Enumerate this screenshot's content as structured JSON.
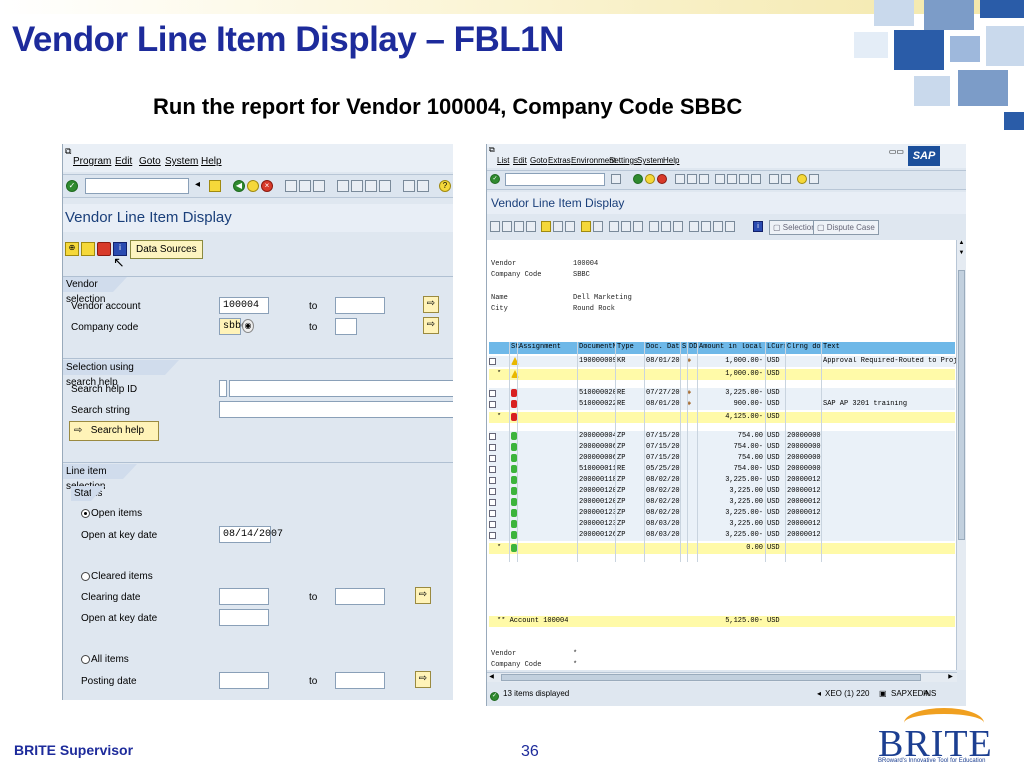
{
  "slide": {
    "title": "Vendor Line Item Display – FBL1N",
    "subtitle": "Run the report for Vendor 100004, Company Code SBBC",
    "footer_left": "BRITE Supervisor",
    "page_number": "36",
    "logo_word": "BRITE",
    "logo_tagline": "BRoward's Innovative Tool for Education"
  },
  "left_window": {
    "menu": [
      "Program",
      "Edit",
      "Goto",
      "System",
      "Help"
    ],
    "title": "Vendor Line Item Display",
    "data_sources_label": "Data Sources",
    "vendor_selection": {
      "header": "Vendor selection",
      "vendor_account_label": "Vendor account",
      "vendor_account_value": "100004",
      "company_code_label": "Company code",
      "company_code_value": "sbbc",
      "to_label": "to"
    },
    "search_help": {
      "header": "Selection using search help",
      "search_help_id_label": "Search help ID",
      "search_string_label": "Search string",
      "search_help_button": "Search help"
    },
    "line_item": {
      "header": "Line item selection",
      "status_label": "Status",
      "open_items_label": "Open items",
      "open_at_key_date_label": "Open at key date",
      "open_at_key_date_value": "08/14/2007",
      "cleared_items_label": "Cleared items",
      "clearing_date_label": "Clearing date",
      "cleared_open_at_key_date_label": "Open at key date",
      "all_items_label": "All items",
      "posting_date_label": "Posting date",
      "to_label": "to"
    }
  },
  "right_window": {
    "menu": [
      "List",
      "Edit",
      "Goto",
      "Extras",
      "Environment",
      "Settings",
      "System",
      "Help"
    ],
    "sap_logo": "SAP",
    "title": "Vendor Line Item Display",
    "selections_label": "Selections",
    "dispute_case_label": "Dispute Case",
    "header_info": {
      "vendor_label": "Vendor",
      "vendor_value": "100004",
      "company_code_label": "Company Code",
      "company_code_value": "SBBC",
      "name_label": "Name",
      "name_value": "Dell Marketing",
      "city_label": "City",
      "city_value": "Round Rock"
    },
    "columns": [
      "St",
      "Assignment",
      "DocumentNo",
      "Type",
      "Doc. Date",
      "S",
      "DD",
      "Amount in local cur.",
      "LCurr",
      "Clrng doc.",
      "Text"
    ],
    "rows": [
      {
        "kind": "item",
        "status": "yellow",
        "doc": "1900000096",
        "type": "KR",
        "date": "08/01/2007",
        "amount": "1,000.00-",
        "curr": "USD",
        "clr": "",
        "text": "Approval Required-Routed to Project Mana",
        "dd": true
      },
      {
        "kind": "subtotal",
        "status": "yellow",
        "amount": "1,000.00-",
        "curr": "USD"
      },
      {
        "kind": "item",
        "status": "red",
        "doc": "5100000205",
        "type": "RE",
        "date": "07/27/2007",
        "amount": "3,225.00-",
        "curr": "USD",
        "clr": "",
        "text": "",
        "dd": true
      },
      {
        "kind": "item",
        "status": "red",
        "doc": "5100000226",
        "type": "RE",
        "date": "08/01/2007",
        "amount": "900.00-",
        "curr": "USD",
        "clr": "",
        "text": "SAP AP 3201 training",
        "dd": true
      },
      {
        "kind": "subtotal",
        "status": "red",
        "amount": "4,125.00-",
        "curr": "USD"
      },
      {
        "kind": "item",
        "status": "green",
        "doc": "2000000047",
        "type": "ZP",
        "date": "07/15/2007",
        "amount": "754.00",
        "curr": "USD",
        "clr": "2000000061",
        "text": ""
      },
      {
        "kind": "item",
        "status": "green",
        "doc": "2000000061",
        "type": "ZP",
        "date": "07/15/2007",
        "amount": "754.00-",
        "curr": "USD",
        "clr": "2000000061",
        "text": ""
      },
      {
        "kind": "item",
        "status": "green",
        "doc": "2000000065",
        "type": "ZP",
        "date": "07/15/2007",
        "amount": "754.00",
        "curr": "USD",
        "clr": "2000000065",
        "text": ""
      },
      {
        "kind": "item",
        "status": "green",
        "doc": "5100000118",
        "type": "RE",
        "date": "05/25/2007",
        "amount": "754.00-",
        "curr": "USD",
        "clr": "2000000065",
        "text": ""
      },
      {
        "kind": "item",
        "status": "green",
        "doc": "2000001181",
        "type": "ZP",
        "date": "08/02/2007",
        "amount": "3,225.00-",
        "curr": "USD",
        "clr": "2000001203",
        "text": ""
      },
      {
        "kind": "item",
        "status": "green",
        "doc": "2000001203",
        "type": "ZP",
        "date": "08/02/2007",
        "amount": "3,225.00",
        "curr": "USD",
        "clr": "2000001203",
        "text": ""
      },
      {
        "kind": "item",
        "status": "green",
        "doc": "2000001207",
        "type": "ZP",
        "date": "08/02/2007",
        "amount": "3,225.00",
        "curr": "USD",
        "clr": "2000001235",
        "text": ""
      },
      {
        "kind": "item",
        "status": "green",
        "doc": "2000001235",
        "type": "ZP",
        "date": "08/02/2007",
        "amount": "3,225.00-",
        "curr": "USD",
        "clr": "2000001235",
        "text": ""
      },
      {
        "kind": "item",
        "status": "green",
        "doc": "2000001239",
        "type": "ZP",
        "date": "08/03/2007",
        "amount": "3,225.00",
        "curr": "USD",
        "clr": "2000001267",
        "text": ""
      },
      {
        "kind": "item",
        "status": "green",
        "doc": "2000001267",
        "type": "ZP",
        "date": "08/03/2007",
        "amount": "3,225.00-",
        "curr": "USD",
        "clr": "2000001267",
        "text": ""
      },
      {
        "kind": "subtotal",
        "status": "green",
        "amount": "0.00",
        "curr": "USD"
      }
    ],
    "account_total_label": "** Account 100004",
    "account_total_amount": "5,125.00-",
    "account_total_curr": "USD",
    "footer_vendor_label": "Vendor",
    "footer_vendor_value": "*",
    "footer_cc_label": "Company Code",
    "footer_cc_value": "*",
    "status_message": "13 items displayed",
    "status_system": "XEO (1) 220",
    "status_server": "SAPXEDA",
    "status_mode": "INS"
  }
}
